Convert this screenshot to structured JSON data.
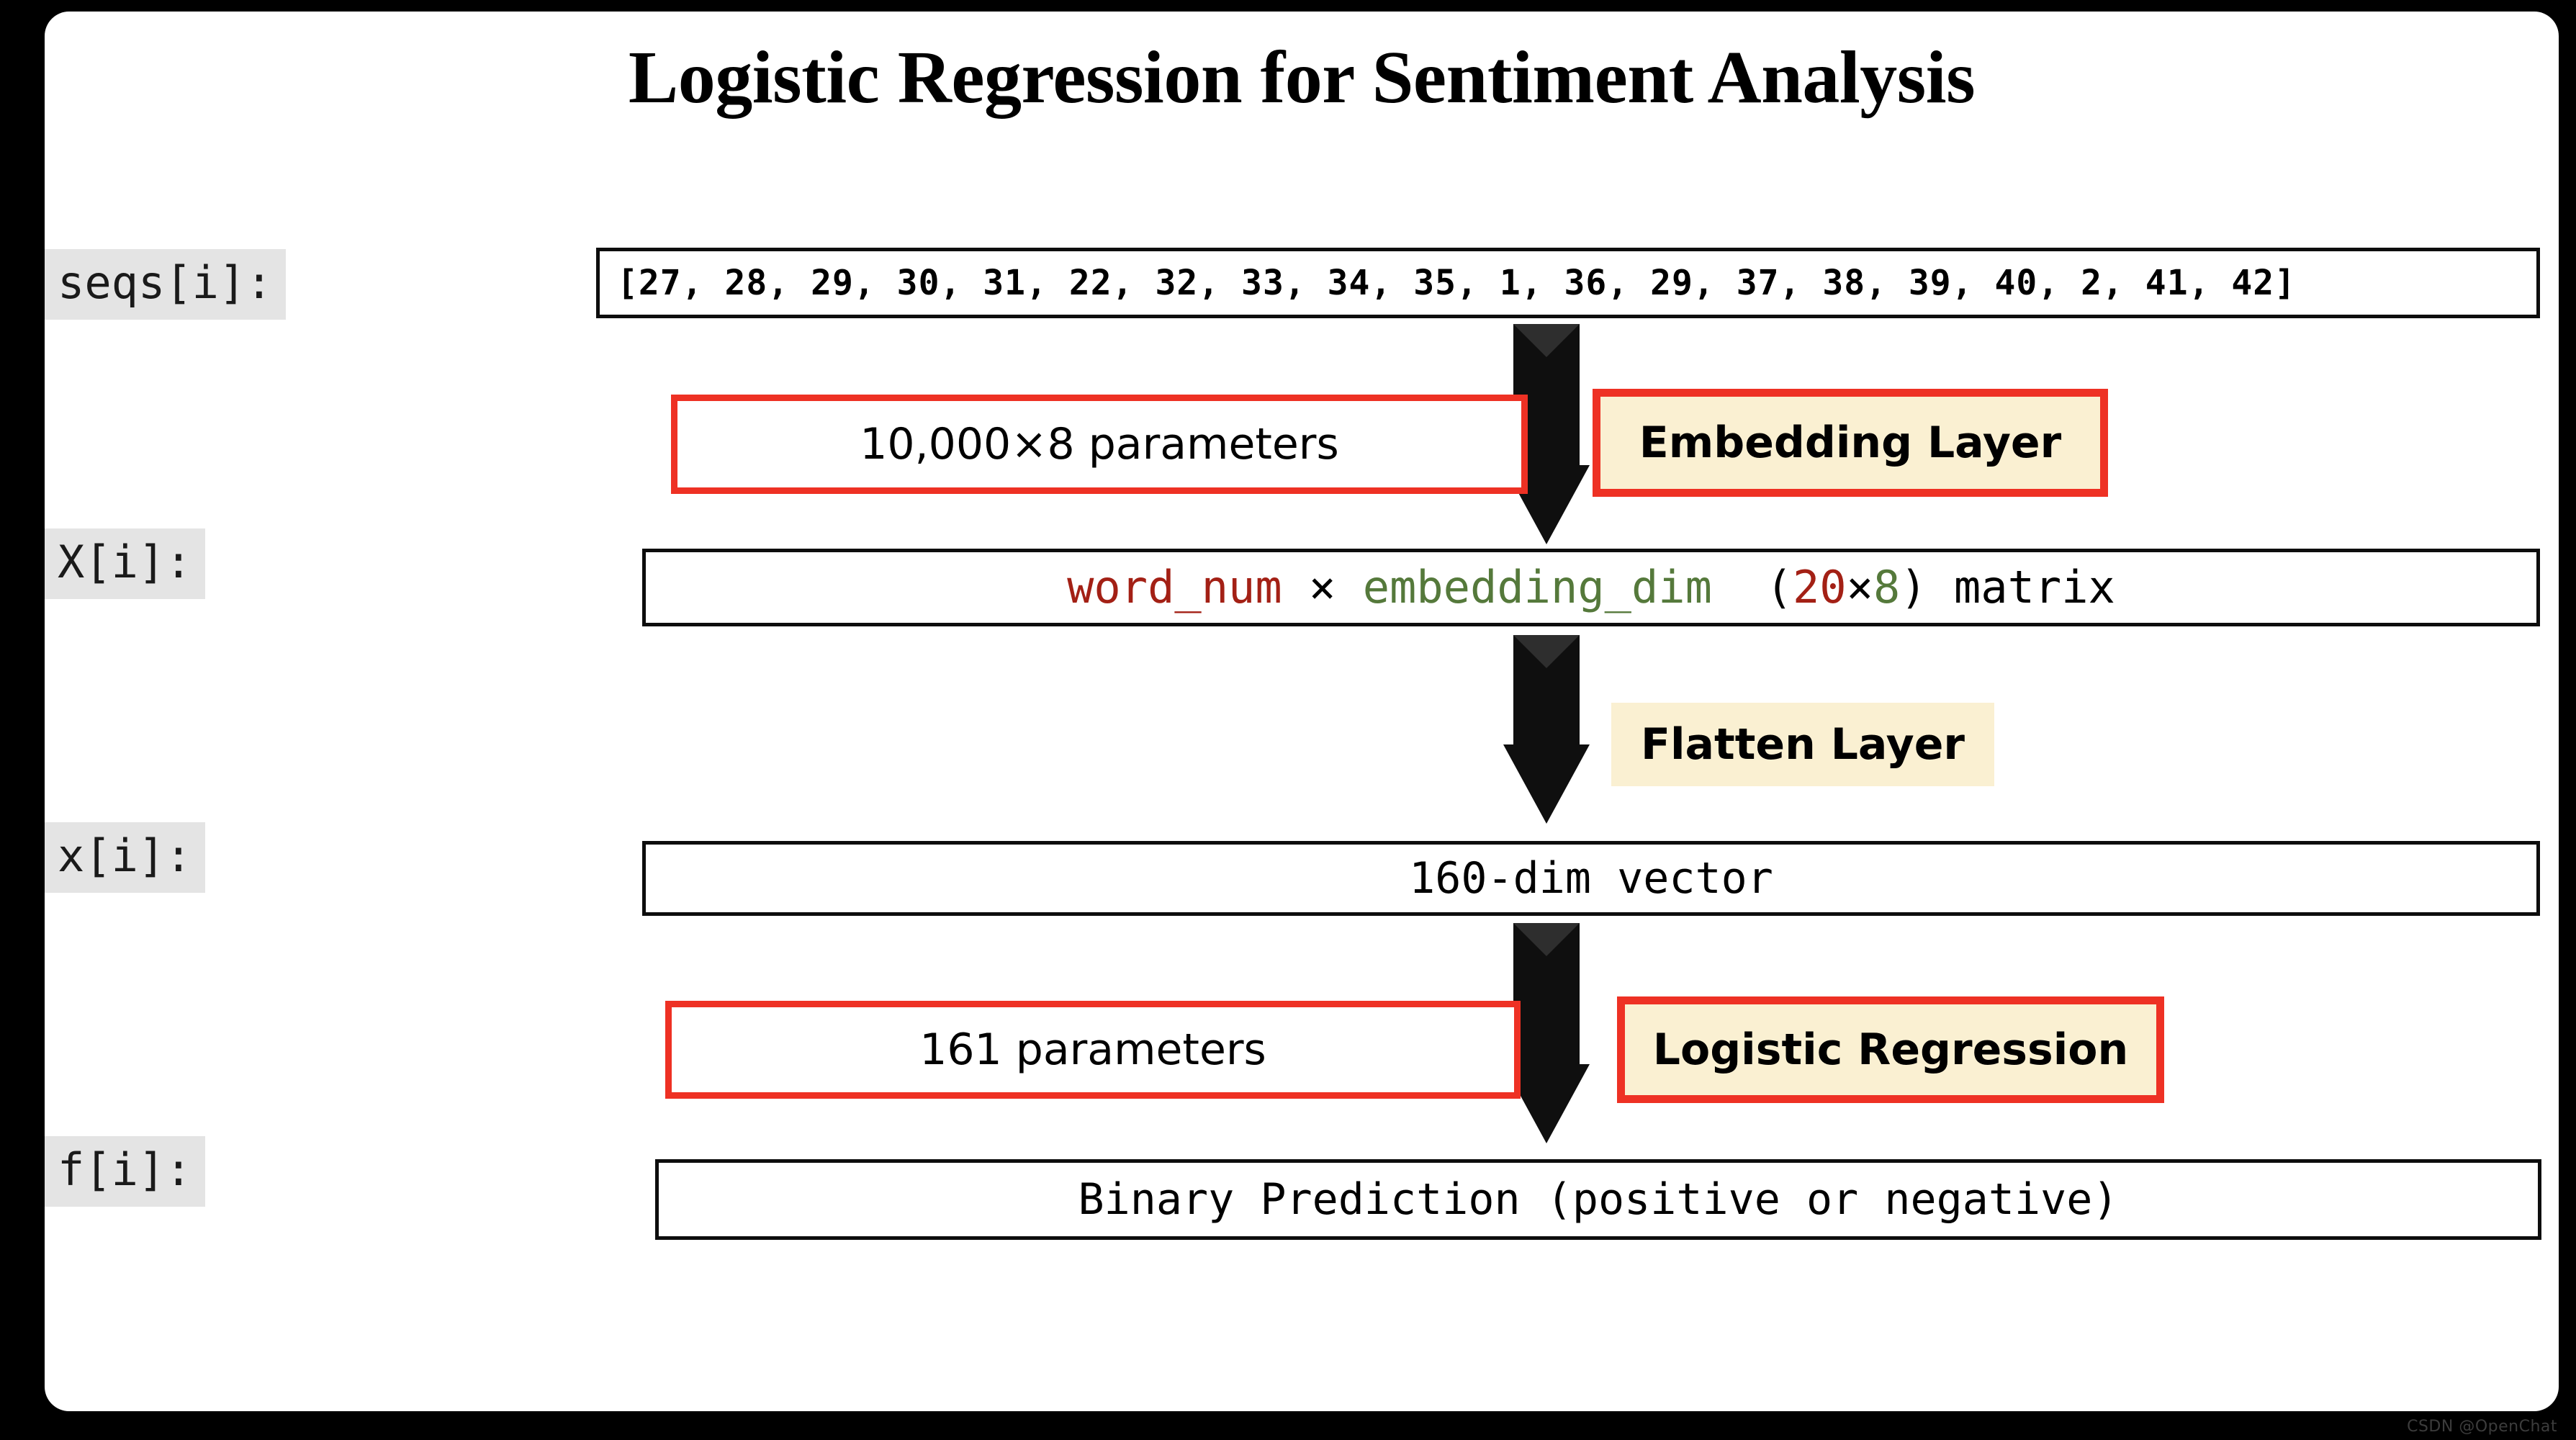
{
  "title": "Logistic Regression for Sentiment Analysis",
  "watermark": "CSDN @OpenChat",
  "colors": {
    "accent_red": "#EE3124",
    "badge_cream": "#FAF0D2",
    "label_gray": "#E4E4E4",
    "code_red": "#A32015",
    "code_green": "#55793B"
  },
  "labels": {
    "seqs": "seqs[i]:",
    "X": "X[i]:",
    "x": "x[i]:",
    "f": "f[i]:"
  },
  "rows": {
    "seqs_value": "[27, 28, 29, 30, 31, 22, 32, 33, 34, 35, 1, 36, 29, 37, 38, 39, 40, 2, 41, 42]",
    "X_value": {
      "word_num": "word_num",
      "times": "×",
      "embedding_dim": "embedding_dim",
      "open_paren": "(",
      "dim_rows": "20",
      "dim_times": "×",
      "dim_cols": "8",
      "close_paren": ")",
      "matrix": "matrix"
    },
    "x_value": {
      "dims": "160-dim",
      "kind": "vector"
    },
    "f_value": {
      "prediction": "Binary Prediction",
      "classes": "(positive or negative)"
    }
  },
  "callouts": {
    "embedding_params": "10,000×8 parameters",
    "logreg_params": "161 parameters"
  },
  "layers": {
    "embedding": "Embedding Layer",
    "flatten": "Flatten Layer",
    "logistic_regression": "Logistic Regression"
  },
  "chart_data": {
    "type": "diagram",
    "title": "Logistic Regression for Sentiment Analysis",
    "nodes": [
      {
        "id": "seqs",
        "label": "seqs[i]:",
        "value": "[27, 28, 29, 30, 31, 22, 32, 33, 34, 35, 1, 36, 29, 37, 38, 39, 40, 2, 41, 42]"
      },
      {
        "id": "X",
        "label": "X[i]:",
        "value": "word_num × embedding_dim (20×8) matrix"
      },
      {
        "id": "x",
        "label": "x[i]:",
        "value": "160-dim vector"
      },
      {
        "id": "f",
        "label": "f[i]:",
        "value": "Binary Prediction (positive or negative)"
      }
    ],
    "edges": [
      {
        "from": "seqs",
        "to": "X",
        "layer": "Embedding Layer",
        "parameters": "10,000×8 parameters"
      },
      {
        "from": "X",
        "to": "x",
        "layer": "Flatten Layer",
        "parameters": ""
      },
      {
        "from": "x",
        "to": "f",
        "layer": "Logistic Regression",
        "parameters": "161 parameters"
      }
    ]
  }
}
